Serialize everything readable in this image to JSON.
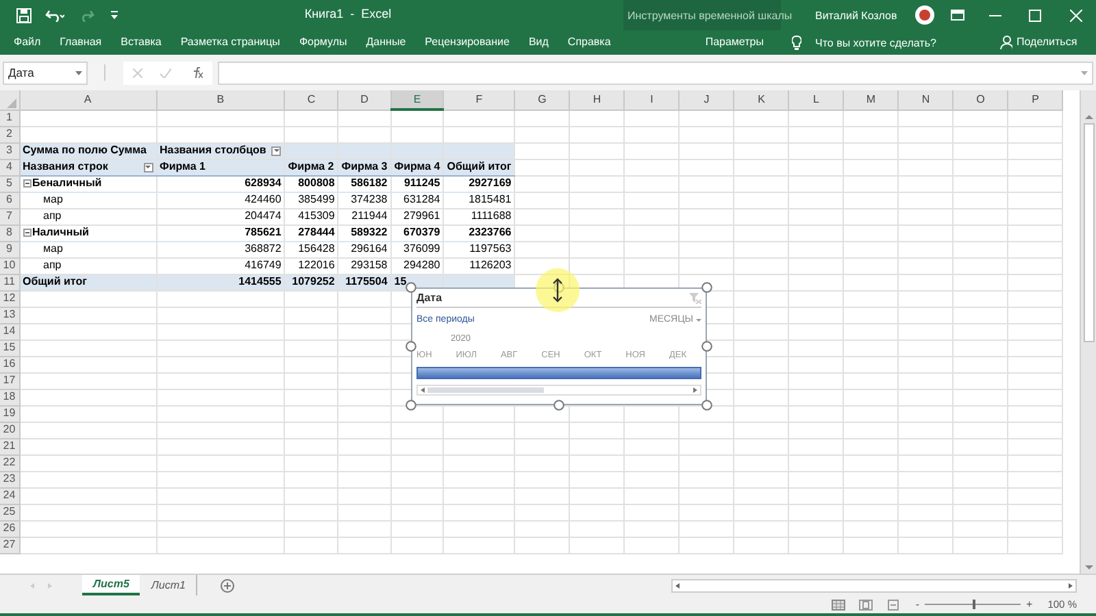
{
  "window": {
    "title": "Книга1  -  Excel",
    "context_group": "Инструменты временной шкалы",
    "user": "Виталий Козлов"
  },
  "ribbon_tabs": [
    {
      "label": "Файл",
      "kind": "normal"
    },
    {
      "label": "Главная",
      "kind": "normal"
    },
    {
      "label": "Вставка",
      "kind": "normal"
    },
    {
      "label": "Разметка страницы",
      "kind": "normal"
    },
    {
      "label": "Формулы",
      "kind": "normal"
    },
    {
      "label": "Данные",
      "kind": "normal"
    },
    {
      "label": "Рецензирование",
      "kind": "normal"
    },
    {
      "label": "Вид",
      "kind": "normal"
    },
    {
      "label": "Справка",
      "kind": "normal"
    },
    {
      "label": "Параметры",
      "kind": "contextual"
    }
  ],
  "tell_me": "Что вы хотите сделать?",
  "share": "Поделиться",
  "formula_bar": {
    "name_box": "Дата"
  },
  "columns": [
    {
      "label": "A",
      "selected": false
    },
    {
      "label": "B",
      "selected": false
    },
    {
      "label": "C",
      "selected": false
    },
    {
      "label": "D",
      "selected": false
    },
    {
      "label": "E",
      "selected": true
    },
    {
      "label": "F",
      "selected": false
    },
    {
      "label": "G",
      "selected": false
    },
    {
      "label": "H",
      "selected": false
    },
    {
      "label": "I",
      "selected": false
    },
    {
      "label": "J",
      "selected": false
    },
    {
      "label": "K",
      "selected": false
    },
    {
      "label": "L",
      "selected": false
    },
    {
      "label": "M",
      "selected": false
    },
    {
      "label": "N",
      "selected": false
    },
    {
      "label": "O",
      "selected": false
    },
    {
      "label": "P",
      "selected": false
    }
  ],
  "row_numbers": [
    "1",
    "2",
    "3",
    "4",
    "5",
    "6",
    "7",
    "8",
    "9",
    "10",
    "11",
    "12",
    "13",
    "14",
    "15",
    "16",
    "17",
    "18",
    "19",
    "20",
    "21",
    "22",
    "23",
    "24",
    "25",
    "26",
    "27"
  ],
  "pivot": {
    "rows": [
      {
        "kind": "title",
        "cells": [
          "Сумма по полю Сумма",
          "Названия столбцов"
        ]
      },
      {
        "kind": "header",
        "cells": [
          "Названия строк",
          "Фирма 1",
          "Фирма 2",
          "Фирма 3",
          "Фирма 4",
          "Общий итог"
        ]
      },
      {
        "kind": "group",
        "expanded": true,
        "cells": [
          "Беналичный",
          "628934",
          "800808",
          "586182",
          "911245",
          "2927169"
        ]
      },
      {
        "kind": "item",
        "cells": [
          "мар",
          "424460",
          "385499",
          "374238",
          "631284",
          "1815481"
        ]
      },
      {
        "kind": "item",
        "cells": [
          "апр",
          "204474",
          "415309",
          "211944",
          "279961",
          "1111688"
        ]
      },
      {
        "kind": "group",
        "expanded": true,
        "cells": [
          "Наличный",
          "785621",
          "278444",
          "589322",
          "670379",
          "2323766"
        ]
      },
      {
        "kind": "item",
        "cells": [
          "мар",
          "368872",
          "156428",
          "296164",
          "376099",
          "1197563"
        ]
      },
      {
        "kind": "item",
        "cells": [
          "апр",
          "416749",
          "122016",
          "293158",
          "294280",
          "1126203"
        ]
      },
      {
        "kind": "total",
        "cells": [
          "Общий итог",
          "1414555",
          "1079252",
          "1175504",
          "15"
        ]
      }
    ]
  },
  "timeline": {
    "title": "Дата",
    "period": "Все периоды",
    "level_label": "МЕСЯЦЫ",
    "year": "2020",
    "months": [
      "ЮН",
      "ИЮЛ",
      "АВГ",
      "СЕН",
      "ОКТ",
      "НОЯ",
      "ДЕК"
    ],
    "level": 1
  },
  "sheets": [
    {
      "label": "Лист5",
      "selected": true
    },
    {
      "label": "Лист1",
      "selected": false
    }
  ],
  "status_bar": {
    "zoom_out": "-",
    "zoom_slider": {
      "level": 0.5
    },
    "zoom_in": "+",
    "zoom": "100 %"
  }
}
